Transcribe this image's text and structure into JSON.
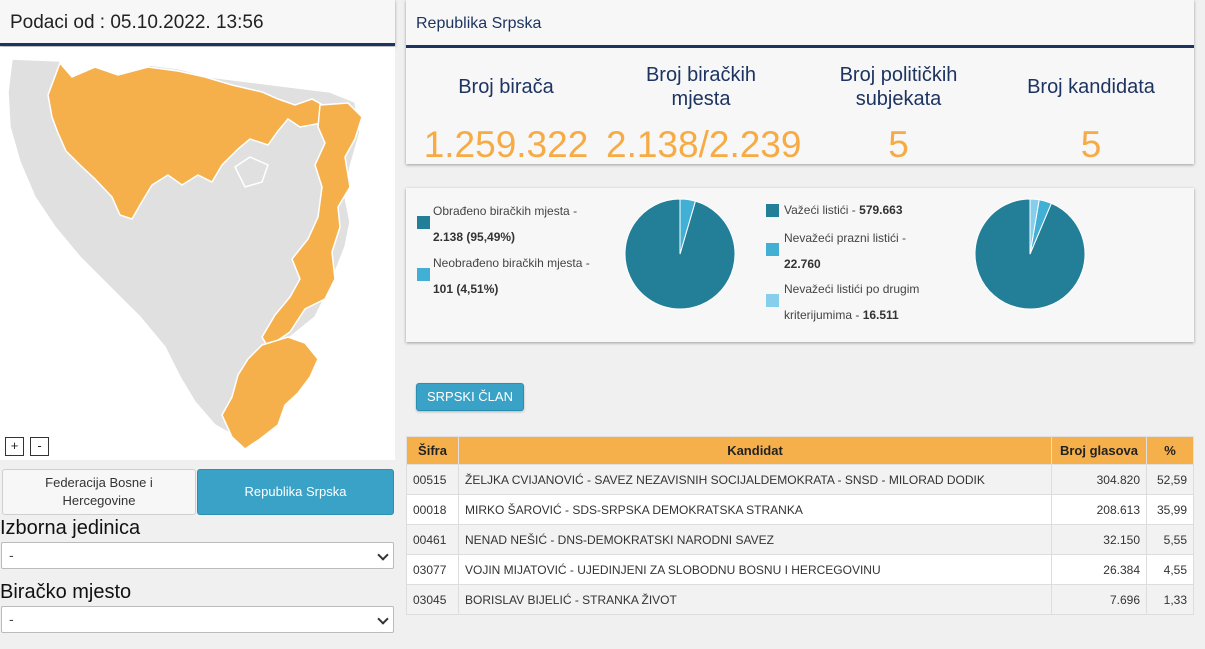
{
  "left_header": {
    "title": "Podaci od : 05.10.2022. 13:56"
  },
  "map": {
    "zoom_in": "+",
    "zoom_out": "-",
    "highlight_color": "#f6b04b",
    "base_color": "#e0e0e0"
  },
  "entities": {
    "fbih": "Federacija Bosne i Hercegovine",
    "rs": "Republika Srpska",
    "active": "rs"
  },
  "filters": {
    "izborna_jedinica": {
      "label": "Izborna jedinica",
      "value": "-"
    },
    "biracko_mjesto": {
      "label": "Biračko mjesto",
      "value": "-"
    }
  },
  "stats": {
    "title": "Republika Srpska",
    "items": [
      {
        "label": "Broj birača",
        "value": "1.259.322"
      },
      {
        "label": "Broj biračkih mjesta",
        "value": "2.138/2.239"
      },
      {
        "label": "Broj političkih subjekata",
        "value": "5"
      },
      {
        "label": "Broj kandidata",
        "value": "5"
      }
    ]
  },
  "pies": {
    "stations": {
      "legend": [
        {
          "label": "Obrađeno biračkih mjesta -",
          "value": "2.138 (95,49%)",
          "color": "#237f97"
        },
        {
          "label": "Neobrađeno biračkih mjesta -",
          "value": "101 (4,51%)",
          "color": "#42b0d5"
        }
      ],
      "values": [
        2138,
        101
      ]
    },
    "ballots": {
      "legend": [
        {
          "label": "Važeći listići -",
          "value": "579.663",
          "color": "#237f97"
        },
        {
          "label": "Nevažeći prazni listići -",
          "value": "22.760",
          "color": "#42b0d5"
        },
        {
          "label": "Nevažeći listići po drugim kriterijumima -",
          "value": "16.511",
          "color": "#87cdec"
        }
      ],
      "values": [
        579663,
        22760,
        16511
      ]
    }
  },
  "member_button": "SRPSKI ČLAN",
  "table": {
    "headers": [
      "Šifra",
      "Kandidat",
      "Broj glasova",
      "%"
    ],
    "rows": [
      [
        "00515",
        "ŽELJKA CVIJANOVIĆ - SAVEZ NEZAVISNIH SOCIJALDEMOKRATA - SNSD - MILORAD DODIK",
        "304.820",
        "52,59"
      ],
      [
        "00018",
        "MIRKO ŠAROVIĆ - SDS-SRPSKA DEMOKRATSKA STRANKA",
        "208.613",
        "35,99"
      ],
      [
        "00461",
        "NENAD NEŠIĆ - DNS-DEMOKRATSKI NARODNI SAVEZ",
        "32.150",
        "5,55"
      ],
      [
        "03077",
        "VOJIN MIJATOVIĆ - UJEDINJENI ZA SLOBODNU BOSNU I HERCEGOVINU",
        "26.384",
        "4,55"
      ],
      [
        "03045",
        "BORISLAV BIJELIĆ - STRANKA ŽIVOT",
        "7.696",
        "1,33"
      ]
    ]
  }
}
